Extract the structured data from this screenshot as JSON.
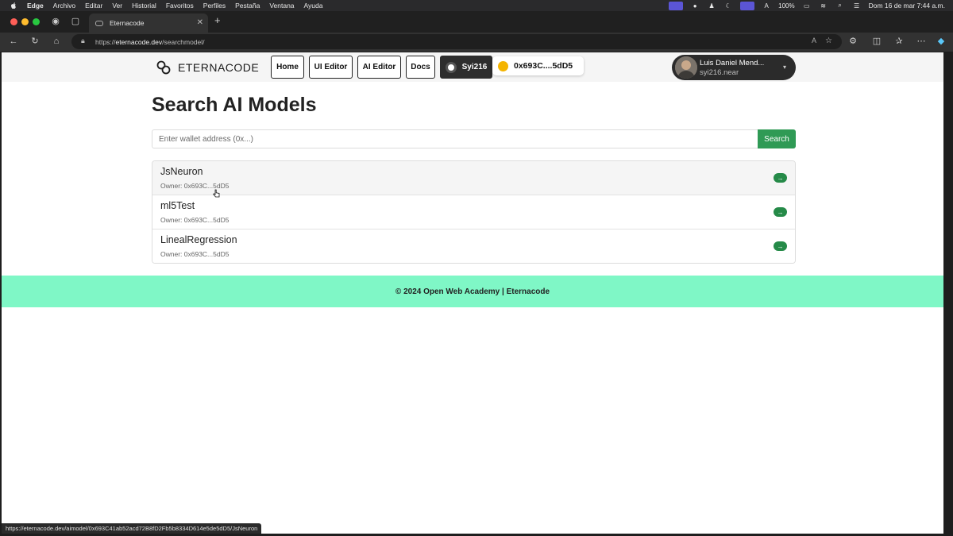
{
  "menubar": {
    "items": [
      "Edge",
      "Archivo",
      "Editar",
      "Ver",
      "Historial",
      "Favoritos",
      "Perfiles",
      "Pestaña",
      "Ventana",
      "Ayuda"
    ],
    "battery": "100%",
    "datetime": "Dom 16 de mar  7:44 a.m."
  },
  "browser": {
    "tab_title": "Eternacode",
    "url_scheme": "https://",
    "url_host": "eternacode.dev",
    "url_path": "/searchmodel/",
    "status_url": "https://eternacode.dev/aimodel/0x693C41ab52acd72B8fD2Fb5b8334D614e5de5dD5/JsNeuron"
  },
  "header": {
    "brand": "ETERNACODE",
    "nav": {
      "home": "Home",
      "ui_editor": "UI Editor",
      "ai_editor": "AI Editor",
      "docs": "Docs",
      "syi": "Syi216"
    },
    "wallet": "0x693C....5dD5",
    "user": {
      "name": "Luis Daniel Mend...",
      "account": "syi216.near"
    }
  },
  "main": {
    "title": "Search AI Models",
    "search_placeholder": "Enter wallet address (0x...)",
    "search_button": "Search",
    "models": [
      {
        "name": "JsNeuron",
        "owner": "Owner: 0x693C...5dD5"
      },
      {
        "name": "ml5Test",
        "owner": "Owner: 0x693C...5dD5"
      },
      {
        "name": "LinealRegression",
        "owner": "Owner: 0x693C...5dD5"
      }
    ],
    "arrow": "→"
  },
  "footer": {
    "text": "© 2024 Open Web Academy | Eternacode"
  },
  "colors": {
    "accent": "#2f9a55",
    "footer_bg": "#7ff7c6",
    "wallet_coin": "#f4b400"
  }
}
